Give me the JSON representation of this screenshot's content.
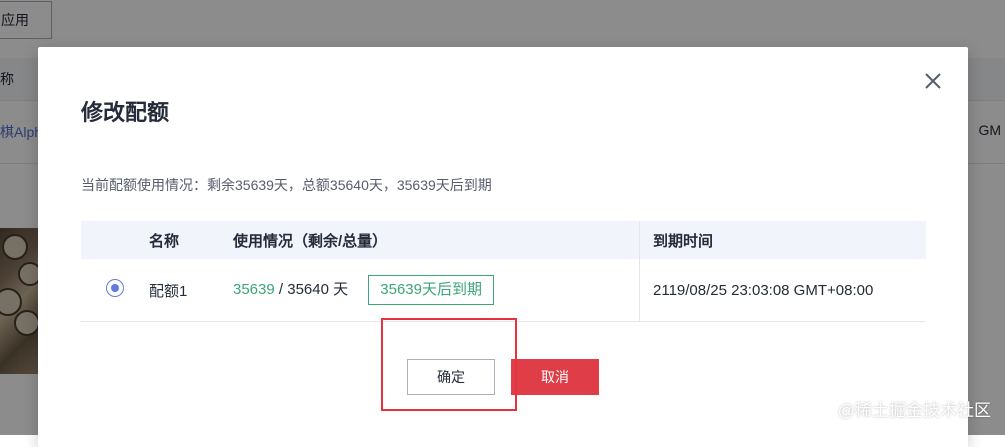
{
  "background": {
    "apply_button": "应用",
    "header_cell": "称",
    "row_link": "棋Alph",
    "right_text": "GM"
  },
  "dialog": {
    "title": "修改配额",
    "summary": "当前配额使用情况：剩余35639天，总额35640天，35639天后到期",
    "table": {
      "headers": [
        "名称",
        "使用情况（剩余/总量）",
        "到期时间"
      ],
      "rows": [
        {
          "selected": true,
          "name": "配额1",
          "remaining": "35639",
          "total": " / 35640 天",
          "expire_tag": "35639天后到期",
          "expiry": "2119/08/25 23:03:08 GMT+08:00"
        }
      ]
    },
    "buttons": {
      "confirm": "确定",
      "cancel": "取消"
    }
  },
  "watermark": "@稀土掘金技术社区",
  "colors": {
    "accent": "#5e7ce0",
    "success": "#3ca579",
    "danger": "#df3e49",
    "annotation": "#e5323d"
  }
}
